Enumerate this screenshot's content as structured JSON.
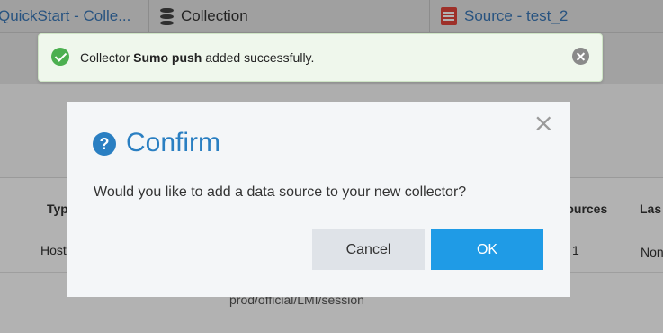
{
  "tabs": [
    {
      "label": "QuickStart - Colle..."
    },
    {
      "label": "Collection",
      "icon": "database-icon"
    },
    {
      "label": "Source - test_2",
      "icon": "source-icon"
    }
  ],
  "table": {
    "headers": [
      "Type",
      "Sources",
      "Las"
    ],
    "row1": [
      "Host",
      "1",
      "Non"
    ],
    "row2": [
      "prod/official/LMI/session"
    ]
  },
  "toast": {
    "prefix": "Collector",
    "name": "Sumo push",
    "suffix": "added successfully.",
    "colors": {
      "success": "#4caf50"
    }
  },
  "modal": {
    "title": "Confirm",
    "icon": "question-icon",
    "message": "Would you like to add a data source to your new collector?",
    "cancel_label": "Cancel",
    "ok_label": "OK",
    "colors": {
      "accent": "#2a7fc2",
      "primary_button": "#1f9be6"
    }
  }
}
